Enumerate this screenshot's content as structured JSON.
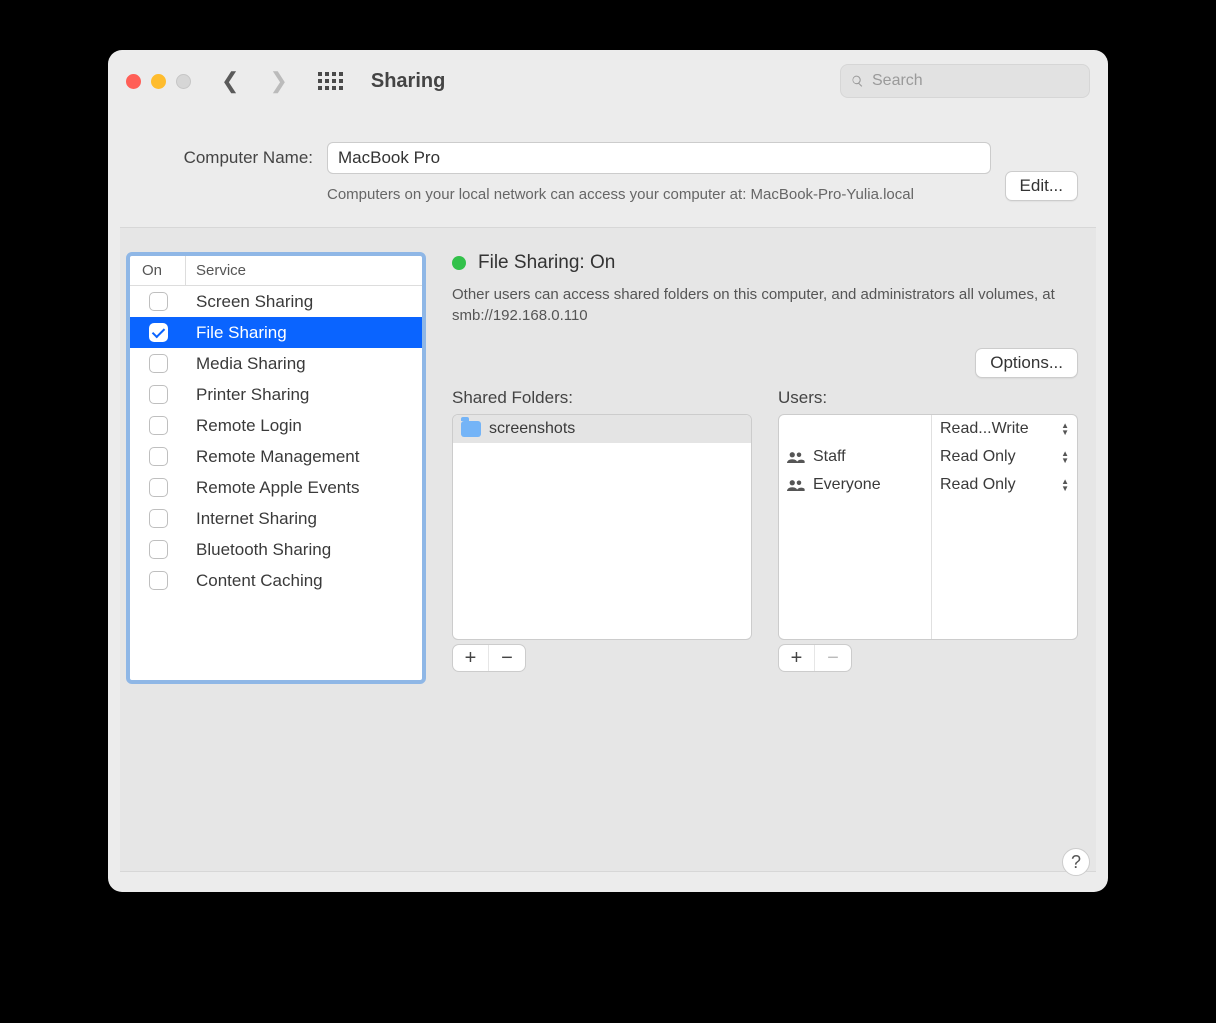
{
  "window": {
    "title": "Sharing"
  },
  "search": {
    "placeholder": "Search"
  },
  "computer": {
    "label": "Computer Name:",
    "value": "MacBook Pro",
    "hint": "Computers on your local network can access your computer at: MacBook-Pro-Yulia.local",
    "edit_label": "Edit..."
  },
  "services": {
    "header_on": "On",
    "header_service": "Service",
    "items": [
      {
        "on": false,
        "name": "Screen Sharing",
        "selected": false
      },
      {
        "on": true,
        "name": "File Sharing",
        "selected": true
      },
      {
        "on": false,
        "name": "Media Sharing",
        "selected": false
      },
      {
        "on": false,
        "name": "Printer Sharing",
        "selected": false
      },
      {
        "on": false,
        "name": "Remote Login",
        "selected": false
      },
      {
        "on": false,
        "name": "Remote Management",
        "selected": false
      },
      {
        "on": false,
        "name": "Remote Apple Events",
        "selected": false
      },
      {
        "on": false,
        "name": "Internet Sharing",
        "selected": false
      },
      {
        "on": false,
        "name": "Bluetooth Sharing",
        "selected": false
      },
      {
        "on": false,
        "name": "Content Caching",
        "selected": false
      }
    ]
  },
  "detail": {
    "status_label": "File Sharing: On",
    "status_color": "#32c14a",
    "description": "Other users can access shared folders on this computer, and administrators all volumes, at smb://192.168.0.110",
    "options_label": "Options...",
    "folders_title": "Shared Folders:",
    "users_title": "Users:",
    "folders": [
      {
        "name": "screenshots",
        "selected": true
      }
    ],
    "users": [
      {
        "name": "",
        "permission": "Read...Write"
      },
      {
        "name": "Staff",
        "permission": "Read Only"
      },
      {
        "name": "Everyone",
        "permission": "Read Only"
      }
    ]
  }
}
